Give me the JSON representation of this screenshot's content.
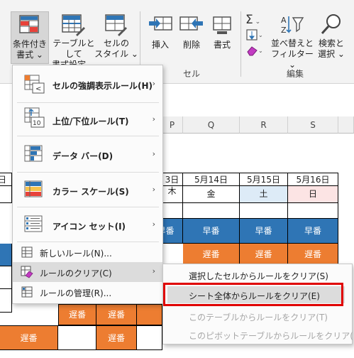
{
  "ribbon": {
    "conditional_format": [
      "条件付き",
      "書式 ⌄"
    ],
    "format_as_table": [
      "テーブルとして",
      "書式設定 ⌄"
    ],
    "cell_styles": [
      "セルの",
      "スタイル ⌄"
    ],
    "insert": "挿入",
    "delete": "削除",
    "format": "書式",
    "sort_filter": [
      "並べ替えと",
      "フィルター ⌄"
    ],
    "find_select": [
      "検索と",
      "選択 ⌄"
    ],
    "group_cells": "セル",
    "group_edit": "編集"
  },
  "columns": [
    "P",
    "Q",
    "R",
    "S"
  ],
  "dates": [
    "3日",
    "5月14日",
    "5月15日",
    "5月16日"
  ],
  "left_date_fragment": "日",
  "weekdays": [
    "木",
    "金",
    "土",
    "日"
  ],
  "shift_early": "早番",
  "shift_late": "遅番",
  "menu": {
    "items": [
      {
        "label": "セルの強調表示ルール(H)",
        "icon": "highlight-cells-icon"
      },
      {
        "label": "上位/下位ルール(T)",
        "icon": "top-bottom-icon"
      },
      {
        "label": "データ バー(D)",
        "icon": "data-bars-icon"
      },
      {
        "label": "カラー スケール(S)",
        "icon": "color-scales-icon"
      },
      {
        "label": "アイコン セット(I)",
        "icon": "icon-sets-icon"
      }
    ],
    "new_rule": "新しいルール(N)...",
    "clear_rules": "ルールのクリア(C)",
    "manage_rules": "ルールの管理(R)..."
  },
  "submenu": {
    "clear_selected": "選択したセルからルールをクリア(S)",
    "clear_sheet": "シート全体からルールをクリア(E)",
    "clear_table": "このテーブルからルールをクリア(T)",
    "clear_pivot": "このピボットテーブルからルールをクリア(P)"
  },
  "colors": {
    "early": "#2f75b5",
    "late": "#ed7d31",
    "saturday": "#ddebf7",
    "sunday": "#fce4e4",
    "highlight": "#e00000",
    "accent_icon": "#2f75b5"
  }
}
